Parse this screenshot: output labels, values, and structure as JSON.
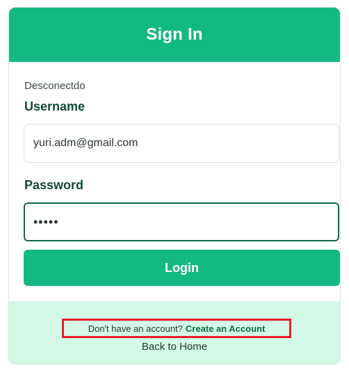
{
  "header": {
    "title": "Sign In"
  },
  "status": {
    "text": "Desconectdo"
  },
  "form": {
    "username_label": "Username",
    "username_value": "yuri.adm@gmail.com",
    "password_label": "Password",
    "password_value": "•••••",
    "login_label": "Login"
  },
  "footer": {
    "signup_question": "Don't have an account?",
    "signup_link": "Create an Account",
    "back_home": "Back to Home"
  },
  "colors": {
    "brand_green": "#14b883",
    "footer_bg": "#d3f8e6",
    "focus_border": "#0f6b4b",
    "highlight_red": "#e81c2b"
  }
}
